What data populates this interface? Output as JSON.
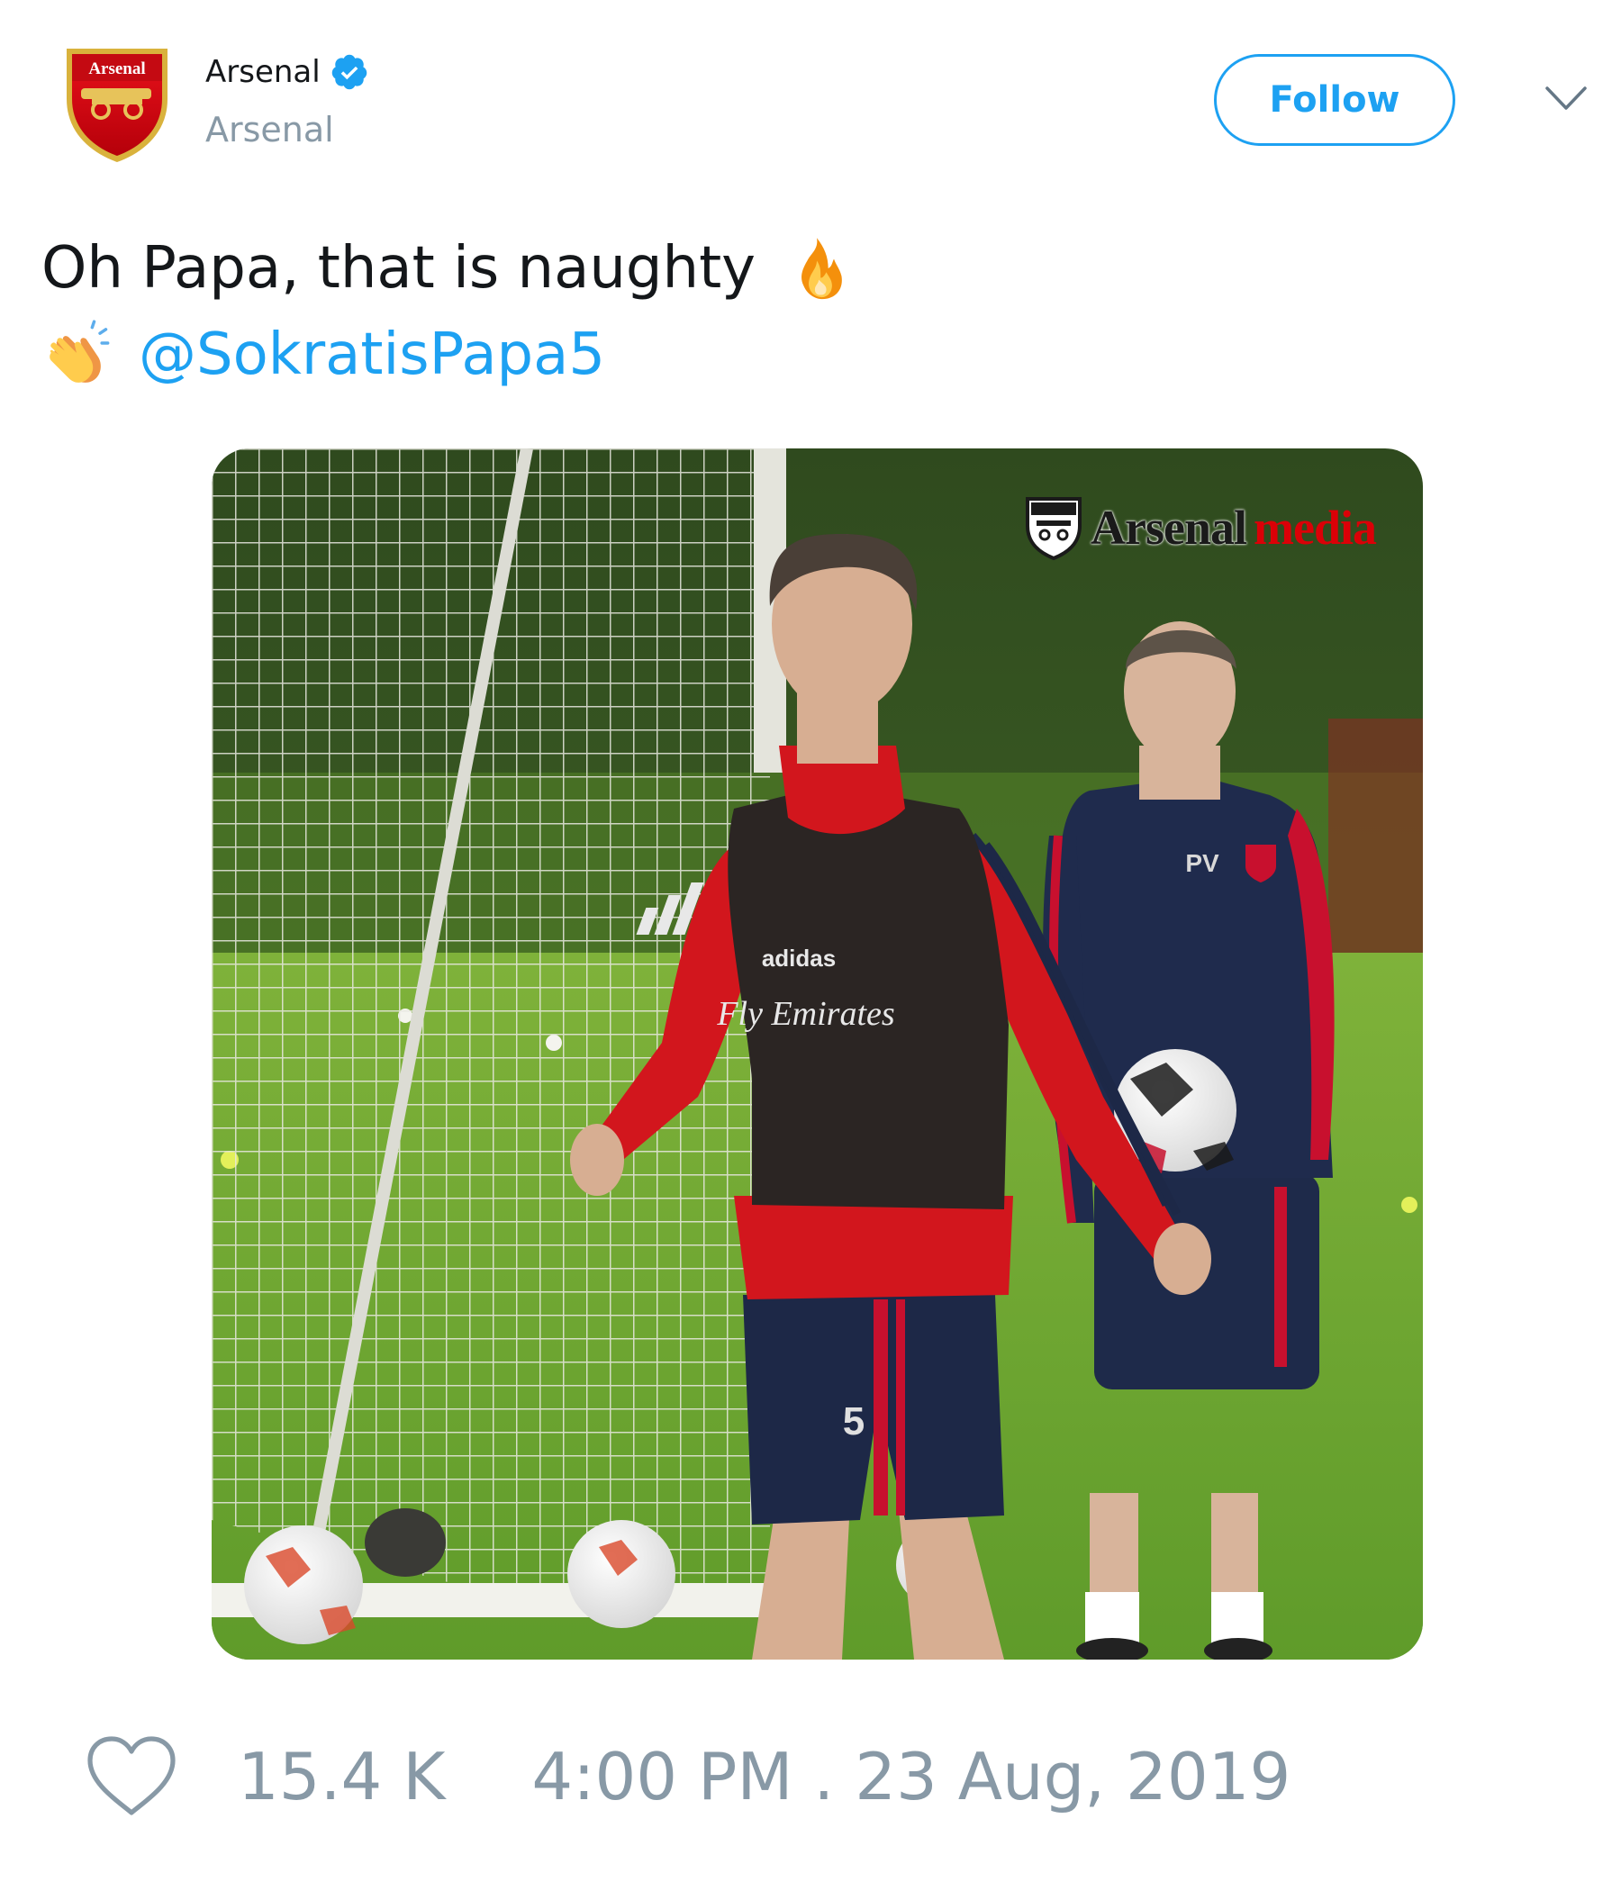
{
  "author": {
    "display_name": "Arsenal",
    "handle": "Arsenal",
    "verified": true,
    "avatar": {
      "icon": "arsenal-crest-icon",
      "lettering": "Arsenal"
    }
  },
  "header": {
    "follow_label": "Follow",
    "menu_icon": "chevron-down-icon"
  },
  "tweet": {
    "text_line_1": "Oh Papa, that is naughty",
    "emoji_1": "fire-emoji",
    "emoji_2": "clapping-hands-emoji",
    "mention": "@SokratisPapa5"
  },
  "media": {
    "type": "video-thumbnail",
    "watermark_part_1": "Arsenal",
    "watermark_part_2": "media",
    "shirt_sponsor": "Fly Emirates",
    "kit_brand": "adidas",
    "shorts_number": "5",
    "coach_initials": "PV"
  },
  "footer": {
    "like_icon": "heart-icon",
    "like_count": "15.4 K",
    "timestamp": "4:00 PM . 23 Aug, 2019"
  },
  "colors": {
    "accent": "#1da1f2",
    "secondary_text": "#8899a6",
    "arsenal_red": "#db0007"
  }
}
